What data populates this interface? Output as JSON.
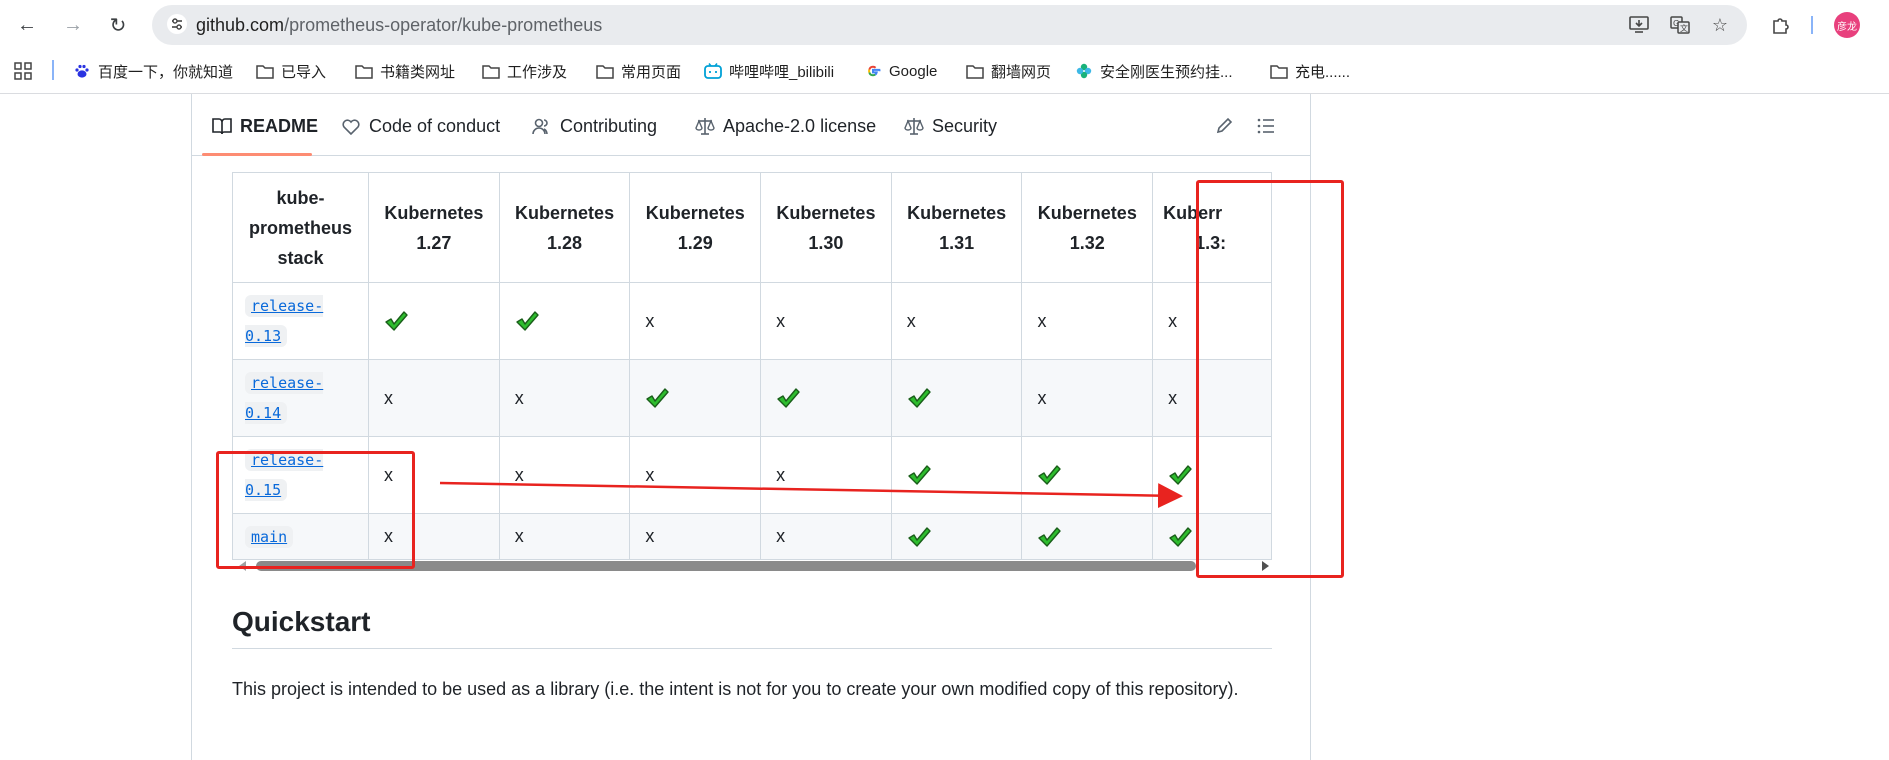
{
  "browser": {
    "url_host": "github.com",
    "url_path": "/prometheus-operator/kube-prometheus",
    "profile_initial": "彦龙"
  },
  "bookmarks": [
    {
      "label": "百度一下，你就知道",
      "icon": "baidu-paw-icon"
    },
    {
      "label": "已导入",
      "icon": "folder-icon"
    },
    {
      "label": "书籍类网址",
      "icon": "folder-icon"
    },
    {
      "label": "工作涉及",
      "icon": "folder-icon"
    },
    {
      "label": "常用页面",
      "icon": "folder-icon"
    },
    {
      "label": "哔哩哔哩_bilibili",
      "icon": "bilibili-icon"
    },
    {
      "label": "Google",
      "icon": "google-g-icon"
    },
    {
      "label": "翻墙网页",
      "icon": "folder-icon"
    },
    {
      "label": "安全刚医生预约挂...",
      "icon": "pinwheel-icon"
    },
    {
      "label": "充电......",
      "icon": "folder-icon"
    }
  ],
  "tabs": [
    {
      "label": "README",
      "icon": "book-icon",
      "active": true
    },
    {
      "label": "Code of conduct",
      "icon": "heart-shield-icon"
    },
    {
      "label": "Contributing",
      "icon": "people-icon"
    },
    {
      "label": "Apache-2.0 license",
      "icon": "scale-icon"
    },
    {
      "label": "Security",
      "icon": "scale-icon"
    }
  ],
  "table": {
    "header_first": [
      "kube-",
      "prometheus",
      "stack"
    ],
    "columns": [
      [
        "Kubernetes",
        "1.27"
      ],
      [
        "Kubernetes",
        "1.28"
      ],
      [
        "Kubernetes",
        "1.29"
      ],
      [
        "Kubernetes",
        "1.30"
      ],
      [
        "Kubernetes",
        "1.31"
      ],
      [
        "Kubernetes",
        "1.32"
      ],
      [
        "Kuberr",
        "1.3:"
      ]
    ],
    "rows": [
      {
        "release": [
          "release-",
          "0.13"
        ],
        "cells": [
          "check",
          "check",
          "x",
          "x",
          "x",
          "x",
          "x"
        ]
      },
      {
        "release": [
          "release-",
          "0.14"
        ],
        "cells": [
          "x",
          "x",
          "check",
          "check",
          "check",
          "x",
          "x"
        ]
      },
      {
        "release": [
          "release-",
          "0.15"
        ],
        "cells": [
          "x",
          "x",
          "x",
          "x",
          "check",
          "check",
          "check"
        ]
      },
      {
        "release": [
          "main"
        ],
        "cells": [
          "x",
          "x",
          "x",
          "x",
          "check",
          "check",
          "check"
        ]
      }
    ],
    "x_glyph": "x"
  },
  "quickstart": {
    "heading": "Quickstart",
    "text": "This project is intended to be used as a library (i.e. the intent is not for you to create your own modified copy of this repository)."
  },
  "colors": {
    "annotation_red": "#e8231f",
    "check_green": "#2ebd2e",
    "link_blue": "#0969da",
    "tab_underline": "#fd8c73"
  }
}
